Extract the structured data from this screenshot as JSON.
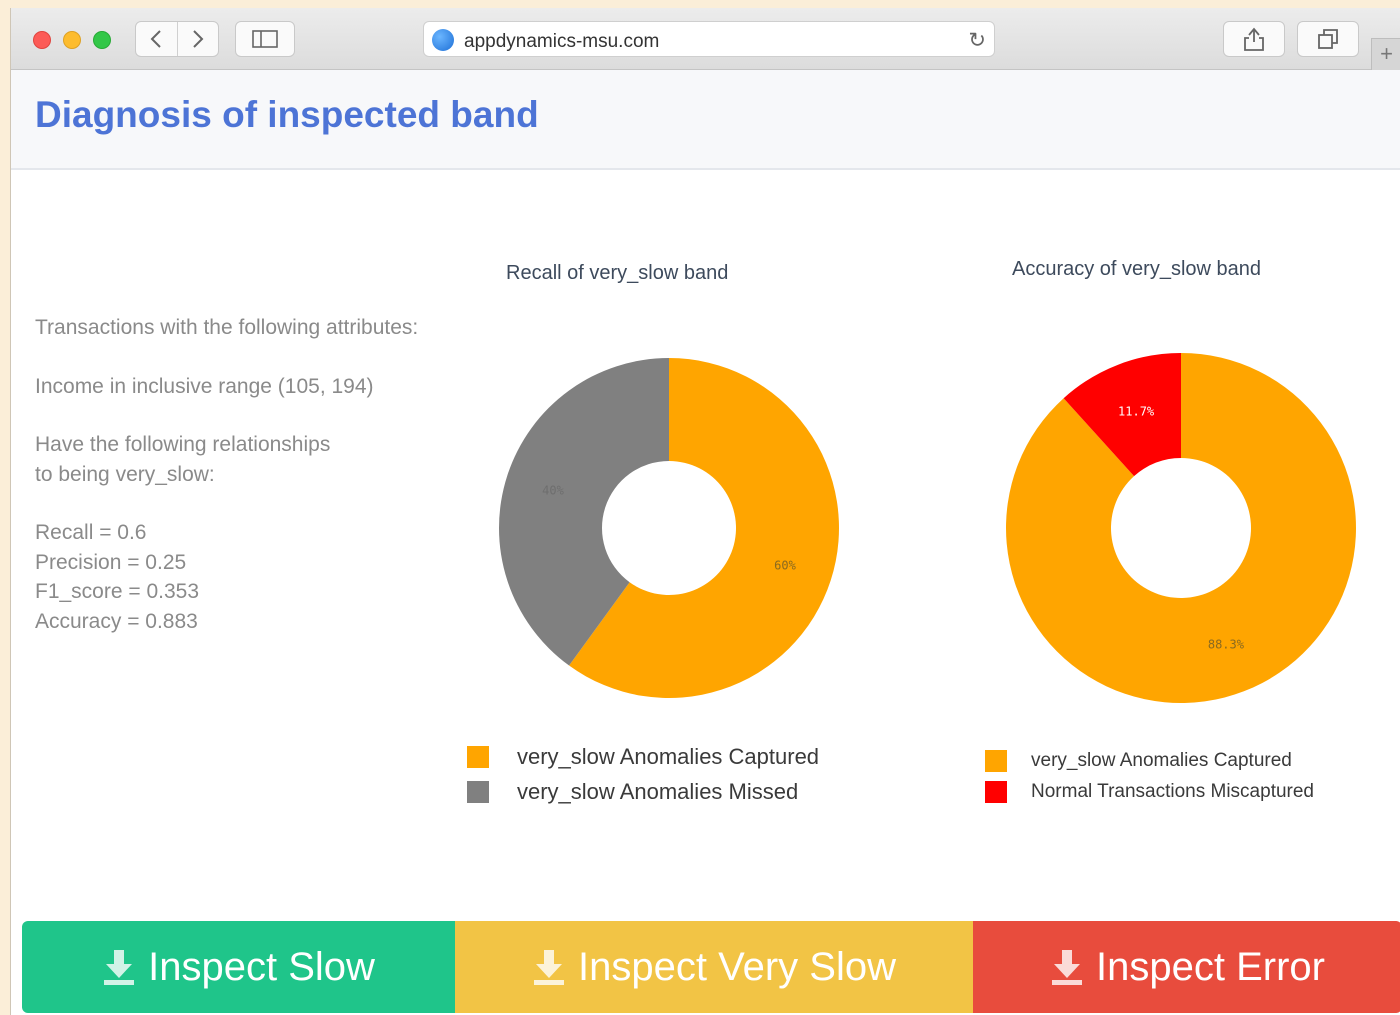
{
  "browser": {
    "url": "appdynamics-msu.com",
    "new_tab_symbol": "+"
  },
  "header": {
    "title": "Diagnosis of inspected band"
  },
  "summary": {
    "intro": "Transactions with the following attributes:",
    "range": "Income in inclusive range (105, 194)",
    "relationship_line1": "Have the following relationships",
    "relationship_line2": "to being very_slow:",
    "recall": "Recall = 0.6",
    "precision": "Precision = 0.25",
    "f1": "F1_score = 0.353",
    "accuracy": "Accuracy = 0.883"
  },
  "chart_data": [
    {
      "type": "pie",
      "title": "Recall of very_slow band",
      "hole": true,
      "categories": [
        "very_slow Anomalies Captured",
        "very_slow Anomalies Missed"
      ],
      "values": [
        60,
        40
      ],
      "labels": [
        "60%",
        "40%"
      ],
      "colors": [
        "#ffa500",
        "#808080"
      ],
      "legend": "bottom"
    },
    {
      "type": "pie",
      "title": "Accuracy of very_slow band",
      "hole": true,
      "categories": [
        "very_slow Anomalies Captured",
        "Normal Transactions Miscaptured"
      ],
      "values": [
        88.3,
        11.7
      ],
      "labels": [
        "88.3%",
        "11.7%"
      ],
      "colors": [
        "#ffa500",
        "#ff0000"
      ],
      "legend": "bottom"
    }
  ],
  "actions": {
    "inspect_slow": "Inspect Slow",
    "inspect_very_slow": "Inspect Very Slow",
    "inspect_error": "Inspect Error"
  },
  "colors": {
    "slow": "#1fc58a",
    "very_slow": "#f2c445",
    "error": "#e84c3d",
    "title": "#4d74d6"
  }
}
